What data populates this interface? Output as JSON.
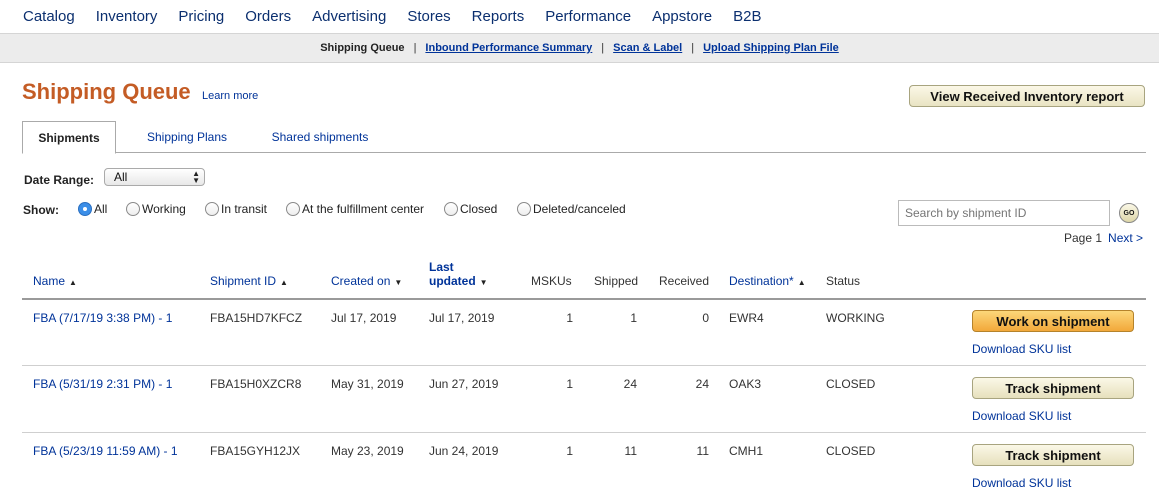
{
  "topnav": [
    "Catalog",
    "Inventory",
    "Pricing",
    "Orders",
    "Advertising",
    "Stores",
    "Reports",
    "Performance",
    "Appstore",
    "B2B"
  ],
  "subnav": {
    "current": "Shipping Queue",
    "links": [
      "Inbound Performance Summary",
      "Scan & Label",
      "Upload Shipping Plan File"
    ]
  },
  "header": {
    "title": "Shipping Queue",
    "learn_more": "Learn more",
    "report_button": "View Received Inventory report"
  },
  "tabs": [
    "Shipments",
    "Shipping Plans",
    "Shared shipments"
  ],
  "filters": {
    "date_range_label": "Date Range:",
    "date_range_value": "All",
    "show_label": "Show:",
    "options": [
      "All",
      "Working",
      "In transit",
      "At the fulfillment center",
      "Closed",
      "Deleted/canceled"
    ],
    "selected": "All",
    "search_placeholder": "Search by shipment ID",
    "go_label": "GO"
  },
  "pager": {
    "page": "Page 1",
    "next": "Next >"
  },
  "table": {
    "headers": {
      "name": "Name",
      "shipment_id": "Shipment ID",
      "created_on": "Created on",
      "last_updated_1": "Last",
      "last_updated_2": "updated",
      "mskus": "MSKUs",
      "shipped": "Shipped",
      "received": "Received",
      "destination": "Destination*",
      "status": "Status"
    },
    "rows": [
      {
        "name": "FBA (7/17/19 3:38 PM) - 1",
        "shipment_id": "FBA15HD7KFCZ",
        "created": "Jul 17, 2019",
        "updated": "Jul 17, 2019",
        "mskus": "1",
        "shipped": "1",
        "received": "0",
        "destination": "EWR4",
        "status": "WORKING",
        "action": "Work on shipment",
        "download": "Download SKU list"
      },
      {
        "name": "FBA (5/31/19 2:31 PM) - 1",
        "shipment_id": "FBA15H0XZCR8",
        "created": "May 31, 2019",
        "updated": "Jun 27, 2019",
        "mskus": "1",
        "shipped": "24",
        "received": "24",
        "destination": "OAK3",
        "status": "CLOSED",
        "action": "Track shipment",
        "download": "Download SKU list"
      },
      {
        "name": "FBA (5/23/19 11:59 AM) - 1",
        "shipment_id": "FBA15GYH12JX",
        "created": "May 23, 2019",
        "updated": "Jun 24, 2019",
        "mskus": "1",
        "shipped": "11",
        "received": "11",
        "destination": "CMH1",
        "status": "CLOSED",
        "action": "Track shipment",
        "download": "Download SKU list"
      }
    ]
  }
}
